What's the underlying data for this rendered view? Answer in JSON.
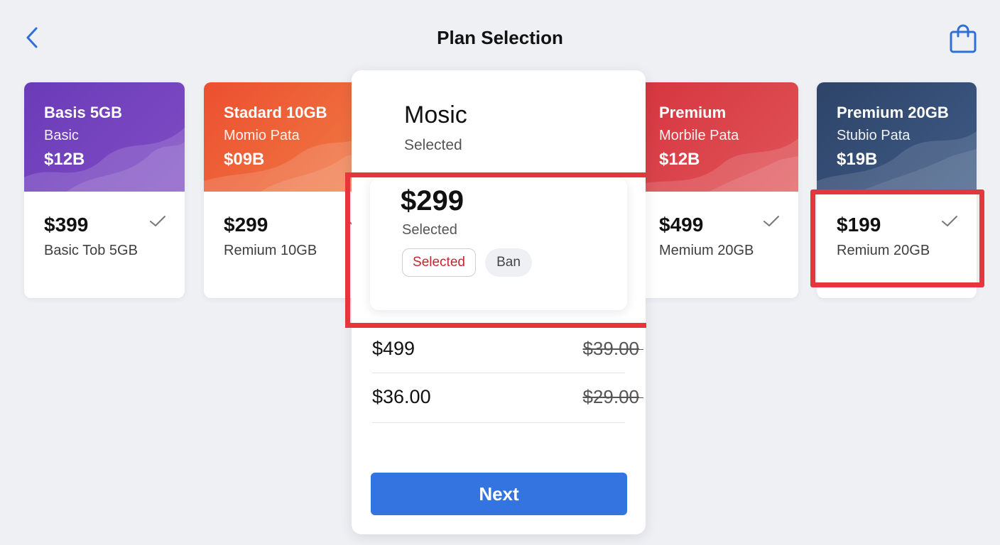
{
  "header": {
    "title": "Plan Selection",
    "back_icon": "chevron-left-icon",
    "bag_icon": "shopping-bag-icon"
  },
  "plans": [
    {
      "name": "Basis 5GB",
      "subtitle": "Basic",
      "code": "$12B",
      "price": "$399",
      "description": "Basic Tob 5GB",
      "color": "#6b3bb8"
    },
    {
      "name": "Stadard 10GB",
      "subtitle": "Momio Pata",
      "code": "$09B",
      "price": "$299",
      "description": "Remium 10GB",
      "color": "#ec4f2f"
    },
    {
      "name": "Premium",
      "subtitle": "Morbile Pata",
      "code": "$12B",
      "price": "$499",
      "description": "Memium 20GB",
      "color": "#d63540"
    },
    {
      "name": "Premium 20GB",
      "subtitle": "Stubio Pata",
      "code": "$19B",
      "price": "$199",
      "description": "Remium 20GB",
      "color": "#2e4468"
    }
  ],
  "selected_plan": {
    "title": "Mosic",
    "status": "Selected",
    "price": "$299",
    "price_status": "Selected",
    "chip_selected": "Selected",
    "chip_other": "Ban",
    "rows": [
      {
        "amount": "$499",
        "old_price": "$39.00"
      },
      {
        "amount": "$36.00",
        "old_price": "$29.00"
      }
    ],
    "next_label": "Next"
  },
  "colors": {
    "accent": "#3474e0",
    "highlight": "#e5353d",
    "chip_text": "#c8262e"
  }
}
